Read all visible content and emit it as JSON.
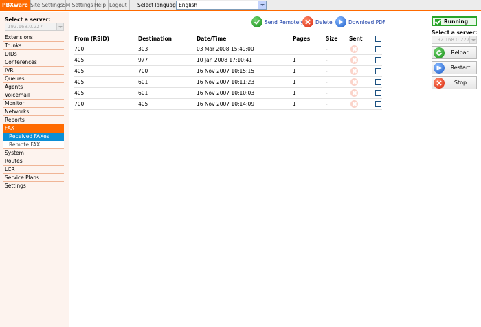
{
  "top_nav": {
    "tabs": [
      "PBXware",
      "Site Settings",
      "SM Settings",
      "Help",
      "Logout"
    ],
    "language_label": "Select language:",
    "language_value": "English"
  },
  "sidebar": {
    "server_label": "Select a server:",
    "server_value": "192.168.0.227",
    "items": [
      "Extensions",
      "Trunks",
      "DIDs",
      "Conferences",
      "IVR",
      "Queues",
      "Agents",
      "Voicemail",
      "Monitor",
      "Networks",
      "Reports"
    ],
    "active_item": "FAX",
    "sub_items": [
      "Received FAXes",
      "Remote FAX"
    ],
    "items_after": [
      "System",
      "Routes",
      "LCR",
      "Service Plans",
      "Settings"
    ]
  },
  "actions": {
    "send_remotely": "Send Remotely",
    "delete": "Delete",
    "download_pdf": "Download PDF"
  },
  "table": {
    "headers": {
      "from": "From (RSID)",
      "destination": "Destination",
      "datetime": "Date/Time",
      "pages": "Pages",
      "size": "Size",
      "sent": "Sent"
    },
    "rows": [
      {
        "from": "700",
        "destination": "303",
        "datetime": "03 Mar 2008 15:49:00",
        "pages": "",
        "size": "-"
      },
      {
        "from": "405",
        "destination": "977",
        "datetime": "10 Jan 2008 17:10:41",
        "pages": "1",
        "size": "-"
      },
      {
        "from": "405",
        "destination": "700",
        "datetime": "16 Nov 2007 10:15:15",
        "pages": "1",
        "size": "-"
      },
      {
        "from": "405",
        "destination": "601",
        "datetime": "16 Nov 2007 10:11:23",
        "pages": "1",
        "size": "-"
      },
      {
        "from": "405",
        "destination": "601",
        "datetime": "16 Nov 2007 10:10:03",
        "pages": "1",
        "size": "-"
      },
      {
        "from": "700",
        "destination": "405",
        "datetime": "16 Nov 2007 10:14:09",
        "pages": "1",
        "size": "-"
      }
    ]
  },
  "right_panel": {
    "status": "Running",
    "server_label": "Select a server:",
    "server_value": "192.168.0.227",
    "reload": "Reload",
    "restart": "Restart",
    "stop": "Stop"
  },
  "colors": {
    "brand_orange": "#ff6a00",
    "selected_blue": "#0b8fd6",
    "running_green": "#2aa52a",
    "link_blue": "#1b3fa8"
  }
}
